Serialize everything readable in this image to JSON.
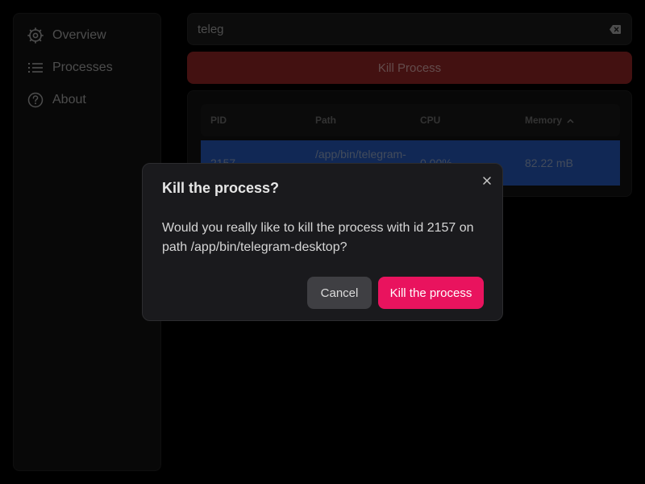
{
  "sidebar": {
    "items": [
      {
        "label": "Overview",
        "icon": "gear-icon"
      },
      {
        "label": "Processes",
        "icon": "list-icon"
      },
      {
        "label": "About",
        "icon": "help-circle-icon"
      }
    ]
  },
  "search": {
    "value": "teleg",
    "clear_icon": "backspace-icon"
  },
  "actions": {
    "kill_label": "Kill Process"
  },
  "table": {
    "columns": [
      "PID",
      "Path",
      "CPU",
      "Memory"
    ],
    "sort": {
      "column": "Memory",
      "direction": "ascending",
      "icon": "chevron-up-icon"
    },
    "rows": [
      {
        "pid": "2157",
        "path": "/app/bin/telegram-",
        "cpu": "0.00%",
        "memory": "82.22 mB",
        "selected": true
      }
    ]
  },
  "dialog": {
    "title": "Kill the process?",
    "body": "Would you really like to kill the process with id 2157 on path /app/bin/telegram-desktop?",
    "cancel_label": "Cancel",
    "confirm_label": "Kill the process",
    "close_icon": "close-icon"
  },
  "colors": {
    "background": "#000000",
    "kill_button": "#7a2020",
    "selected_row": "#1f4a9b",
    "confirm_button": "#e9135e",
    "cancel_button": "#3f3f43"
  }
}
